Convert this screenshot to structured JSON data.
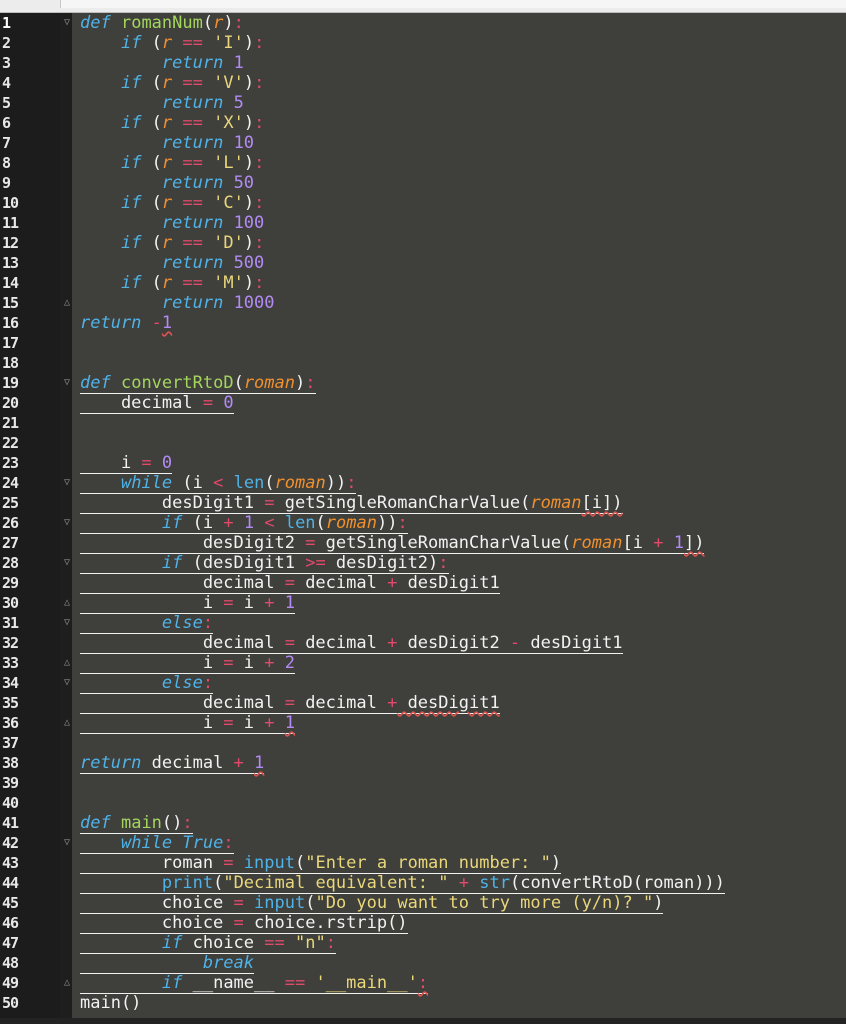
{
  "editor": {
    "line_numbers": [
      "1",
      "2",
      "3",
      "4",
      "5",
      "6",
      "7",
      "8",
      "9",
      "10",
      "11",
      "12",
      "13",
      "14",
      "15",
      "16",
      "17",
      "18",
      "19",
      "20",
      "21",
      "22",
      "23",
      "24",
      "25",
      "26",
      "27",
      "28",
      "29",
      "30",
      "31",
      "32",
      "33",
      "34",
      "35",
      "36",
      "37",
      "38",
      "39",
      "40",
      "41",
      "42",
      "43",
      "44",
      "45",
      "46",
      "47",
      "48",
      "49",
      "50"
    ],
    "lines": [
      [
        [
          "kw",
          "def"
        ],
        [
          "pl",
          " "
        ],
        [
          "fn",
          "romanNum"
        ],
        [
          "pl",
          "("
        ],
        [
          "pr",
          "r"
        ],
        [
          "pl",
          ")"
        ],
        [
          "op",
          ":"
        ]
      ],
      [
        [
          "pl",
          "    "
        ],
        [
          "kw",
          "if"
        ],
        [
          "pl",
          " ("
        ],
        [
          "pr",
          "r"
        ],
        [
          "pl",
          " "
        ],
        [
          "op",
          "=="
        ],
        [
          "pl",
          " "
        ],
        [
          "str",
          "'I'"
        ],
        [
          "pl",
          ")"
        ],
        [
          "op",
          ":"
        ]
      ],
      [
        [
          "pl",
          "        "
        ],
        [
          "kw",
          "return"
        ],
        [
          "pl",
          " "
        ],
        [
          "num",
          "1"
        ]
      ],
      [
        [
          "pl",
          "    "
        ],
        [
          "kw",
          "if"
        ],
        [
          "pl",
          " ("
        ],
        [
          "pr",
          "r"
        ],
        [
          "pl",
          " "
        ],
        [
          "op",
          "=="
        ],
        [
          "pl",
          " "
        ],
        [
          "str",
          "'V'"
        ],
        [
          "pl",
          ")"
        ],
        [
          "op",
          ":"
        ]
      ],
      [
        [
          "pl",
          "        "
        ],
        [
          "kw",
          "return"
        ],
        [
          "pl",
          " "
        ],
        [
          "num",
          "5"
        ]
      ],
      [
        [
          "pl",
          "    "
        ],
        [
          "kw",
          "if"
        ],
        [
          "pl",
          " ("
        ],
        [
          "pr",
          "r"
        ],
        [
          "pl",
          " "
        ],
        [
          "op",
          "=="
        ],
        [
          "pl",
          " "
        ],
        [
          "str",
          "'X'"
        ],
        [
          "pl",
          ")"
        ],
        [
          "op",
          ":"
        ]
      ],
      [
        [
          "pl",
          "        "
        ],
        [
          "kw",
          "return"
        ],
        [
          "pl",
          " "
        ],
        [
          "num",
          "10"
        ]
      ],
      [
        [
          "pl",
          "    "
        ],
        [
          "kw",
          "if"
        ],
        [
          "pl",
          " ("
        ],
        [
          "pr",
          "r"
        ],
        [
          "pl",
          " "
        ],
        [
          "op",
          "=="
        ],
        [
          "pl",
          " "
        ],
        [
          "str",
          "'L'"
        ],
        [
          "pl",
          ")"
        ],
        [
          "op",
          ":"
        ]
      ],
      [
        [
          "pl",
          "        "
        ],
        [
          "kw",
          "return"
        ],
        [
          "pl",
          " "
        ],
        [
          "num",
          "50"
        ]
      ],
      [
        [
          "pl",
          "    "
        ],
        [
          "kw",
          "if"
        ],
        [
          "pl",
          " ("
        ],
        [
          "pr",
          "r"
        ],
        [
          "pl",
          " "
        ],
        [
          "op",
          "=="
        ],
        [
          "pl",
          " "
        ],
        [
          "str",
          "'C'"
        ],
        [
          "pl",
          ")"
        ],
        [
          "op",
          ":"
        ]
      ],
      [
        [
          "pl",
          "        "
        ],
        [
          "kw",
          "return"
        ],
        [
          "pl",
          " "
        ],
        [
          "num",
          "100"
        ]
      ],
      [
        [
          "pl",
          "    "
        ],
        [
          "kw",
          "if"
        ],
        [
          "pl",
          " ("
        ],
        [
          "pr",
          "r"
        ],
        [
          "pl",
          " "
        ],
        [
          "op",
          "=="
        ],
        [
          "pl",
          " "
        ],
        [
          "str",
          "'D'"
        ],
        [
          "pl",
          ")"
        ],
        [
          "op",
          ":"
        ]
      ],
      [
        [
          "pl",
          "        "
        ],
        [
          "kw",
          "return"
        ],
        [
          "pl",
          " "
        ],
        [
          "num",
          "500"
        ]
      ],
      [
        [
          "pl",
          "    "
        ],
        [
          "kw",
          "if"
        ],
        [
          "pl",
          " ("
        ],
        [
          "pr",
          "r"
        ],
        [
          "pl",
          " "
        ],
        [
          "op",
          "=="
        ],
        [
          "pl",
          " "
        ],
        [
          "str",
          "'M'"
        ],
        [
          "pl",
          ")"
        ],
        [
          "op",
          ":"
        ]
      ],
      [
        [
          "pl",
          "        "
        ],
        [
          "kw",
          "return"
        ],
        [
          "pl",
          " "
        ],
        [
          "num",
          "1000"
        ]
      ],
      [
        [
          "kw",
          "return"
        ],
        [
          "pl",
          " "
        ],
        [
          "op",
          "-"
        ],
        [
          "num",
          "1"
        ]
      ],
      [],
      [],
      [
        [
          "kw",
          "def"
        ],
        [
          "pl",
          " "
        ],
        [
          "fn",
          "convertRtoD"
        ],
        [
          "pl",
          "("
        ],
        [
          "pr",
          "roman"
        ],
        [
          "pl",
          ")"
        ],
        [
          "op",
          ":"
        ]
      ],
      [
        [
          "pl",
          "    decimal "
        ],
        [
          "op",
          "="
        ],
        [
          "pl",
          " "
        ],
        [
          "num",
          "0"
        ]
      ],
      [],
      [],
      [
        [
          "pl",
          "    i "
        ],
        [
          "op",
          "="
        ],
        [
          "pl",
          " "
        ],
        [
          "num",
          "0"
        ]
      ],
      [
        [
          "pl",
          "    "
        ],
        [
          "kw",
          "while"
        ],
        [
          "pl",
          " (i "
        ],
        [
          "op",
          "<"
        ],
        [
          "pl",
          " "
        ],
        [
          "bi",
          "len"
        ],
        [
          "pl",
          "("
        ],
        [
          "pr",
          "roman"
        ],
        [
          "pl",
          "))"
        ],
        [
          "op",
          ":"
        ]
      ],
      [
        [
          "pl",
          "        desDigit1 "
        ],
        [
          "op",
          "="
        ],
        [
          "pl",
          " getSingleRomanCharValue("
        ],
        [
          "pr",
          "roman"
        ],
        [
          "pl",
          "[i])"
        ]
      ],
      [
        [
          "pl",
          "        "
        ],
        [
          "kw",
          "if"
        ],
        [
          "pl",
          " (i "
        ],
        [
          "op",
          "+"
        ],
        [
          "pl",
          " "
        ],
        [
          "num",
          "1"
        ],
        [
          "pl",
          " "
        ],
        [
          "op",
          "<"
        ],
        [
          "pl",
          " "
        ],
        [
          "bi",
          "len"
        ],
        [
          "pl",
          "("
        ],
        [
          "pr",
          "roman"
        ],
        [
          "pl",
          "))"
        ],
        [
          "op",
          ":"
        ]
      ],
      [
        [
          "pl",
          "            desDigit2 "
        ],
        [
          "op",
          "="
        ],
        [
          "pl",
          " getSingleRomanCharValue("
        ],
        [
          "pr",
          "roman"
        ],
        [
          "pl",
          "[i "
        ],
        [
          "op",
          "+"
        ],
        [
          "pl",
          " "
        ],
        [
          "num",
          "1"
        ],
        [
          "pl",
          "])"
        ]
      ],
      [
        [
          "pl",
          "        "
        ],
        [
          "kw",
          "if"
        ],
        [
          "pl",
          " (desDigit1 "
        ],
        [
          "op",
          ">="
        ],
        [
          "pl",
          " desDigit2)"
        ],
        [
          "op",
          ":"
        ]
      ],
      [
        [
          "pl",
          "            decimal "
        ],
        [
          "op",
          "="
        ],
        [
          "pl",
          " decimal "
        ],
        [
          "op",
          "+"
        ],
        [
          "pl",
          " desDigit1"
        ]
      ],
      [
        [
          "pl",
          "            i "
        ],
        [
          "op",
          "="
        ],
        [
          "pl",
          " i "
        ],
        [
          "op",
          "+"
        ],
        [
          "pl",
          " "
        ],
        [
          "num",
          "1"
        ]
      ],
      [
        [
          "pl",
          "        "
        ],
        [
          "kw",
          "else"
        ],
        [
          "op",
          ":"
        ]
      ],
      [
        [
          "pl",
          "            decimal "
        ],
        [
          "op",
          "="
        ],
        [
          "pl",
          " decimal "
        ],
        [
          "op",
          "+"
        ],
        [
          "pl",
          " desDigit2 "
        ],
        [
          "op",
          "-"
        ],
        [
          "pl",
          " desDigit1"
        ]
      ],
      [
        [
          "pl",
          "            i "
        ],
        [
          "op",
          "="
        ],
        [
          "pl",
          " i "
        ],
        [
          "op",
          "+"
        ],
        [
          "pl",
          " "
        ],
        [
          "num",
          "2"
        ]
      ],
      [
        [
          "pl",
          "        "
        ],
        [
          "kw",
          "else"
        ],
        [
          "op",
          ":"
        ]
      ],
      [
        [
          "pl",
          "            decimal "
        ],
        [
          "op",
          "="
        ],
        [
          "pl",
          " decimal "
        ],
        [
          "op",
          "+"
        ],
        [
          "pl",
          " desDigit1"
        ]
      ],
      [
        [
          "pl",
          "            i "
        ],
        [
          "op",
          "="
        ],
        [
          "pl",
          " i "
        ],
        [
          "op",
          "+"
        ],
        [
          "pl",
          " "
        ],
        [
          "num",
          "1"
        ]
      ],
      [],
      [
        [
          "kw",
          "return"
        ],
        [
          "pl",
          " decimal "
        ],
        [
          "op",
          "+"
        ],
        [
          "pl",
          " "
        ],
        [
          "num",
          "1"
        ]
      ],
      [],
      [],
      [
        [
          "kw",
          "def"
        ],
        [
          "pl",
          " "
        ],
        [
          "fn",
          "main"
        ],
        [
          "pl",
          "()"
        ],
        [
          "op",
          ":"
        ]
      ],
      [
        [
          "pl",
          "    "
        ],
        [
          "kw",
          "while"
        ],
        [
          "pl",
          " "
        ],
        [
          "kw",
          "True"
        ],
        [
          "op",
          ":"
        ]
      ],
      [
        [
          "pl",
          "        roman "
        ],
        [
          "op",
          "="
        ],
        [
          "pl",
          " "
        ],
        [
          "bi",
          "input"
        ],
        [
          "pl",
          "("
        ],
        [
          "str",
          "\"Enter a roman number: \""
        ],
        [
          "pl",
          ")"
        ]
      ],
      [
        [
          "pl",
          "        "
        ],
        [
          "bi",
          "print"
        ],
        [
          "pl",
          "("
        ],
        [
          "str",
          "\"Decimal equivalent: \""
        ],
        [
          "pl",
          " "
        ],
        [
          "op",
          "+"
        ],
        [
          "pl",
          " "
        ],
        [
          "bi",
          "str"
        ],
        [
          "pl",
          "(convertRtoD(roman)))"
        ]
      ],
      [
        [
          "pl",
          "        choice "
        ],
        [
          "op",
          "="
        ],
        [
          "pl",
          " "
        ],
        [
          "bi",
          "input"
        ],
        [
          "pl",
          "("
        ],
        [
          "str",
          "\"Do you want to try more (y/n)? \""
        ],
        [
          "pl",
          ")"
        ]
      ],
      [
        [
          "pl",
          "        choice "
        ],
        [
          "op",
          "="
        ],
        [
          "pl",
          " choice.rstrip()"
        ]
      ],
      [
        [
          "pl",
          "        "
        ],
        [
          "kw",
          "if"
        ],
        [
          "pl",
          " choice "
        ],
        [
          "op",
          "=="
        ],
        [
          "pl",
          " "
        ],
        [
          "str",
          "\"n\""
        ],
        [
          "op",
          ":"
        ]
      ],
      [
        [
          "pl",
          "            "
        ],
        [
          "kw",
          "break"
        ]
      ],
      [
        [
          "pl",
          "        "
        ],
        [
          "kw",
          "if"
        ],
        [
          "pl",
          " __name__ "
        ],
        [
          "op",
          "=="
        ],
        [
          "pl",
          " "
        ],
        [
          "str",
          "'__main__'"
        ],
        [
          "op",
          ":"
        ]
      ],
      [
        [
          "pl",
          "main()"
        ]
      ]
    ]
  },
  "colors": {
    "background": "#3f3f3c",
    "gutter": "#1c1c1c",
    "keyword": "#4fb3e8",
    "function_name": "#a4d65e",
    "parameter": "#f0902e",
    "operator": "#e24a6a",
    "string": "#e9d77a",
    "number": "#b38bf5",
    "plain": "#f2f2f2"
  }
}
